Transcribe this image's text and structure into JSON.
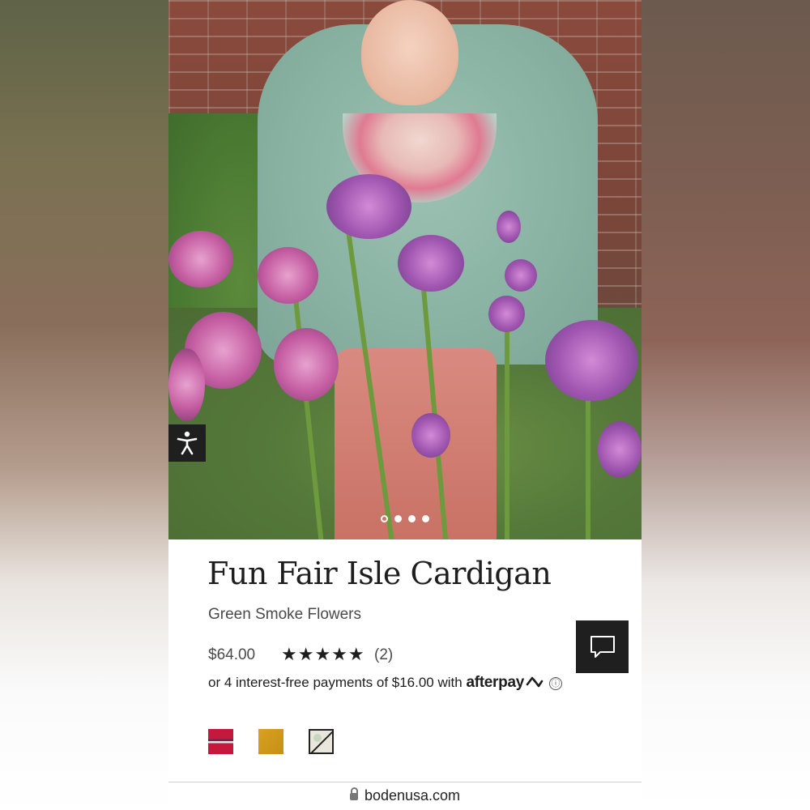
{
  "product": {
    "title": "Fun Fair Isle Cardigan",
    "color_name": "Green Smoke Flowers",
    "price": "$64.00",
    "rating_stars": "★★★★★",
    "rating_value": 5,
    "review_count": "(2)"
  },
  "afterpay": {
    "text": "or 4 interest-free payments of $16.00 with",
    "brand": "afterpay",
    "info_icon_glyph": "ⓘ"
  },
  "gallery": {
    "total_images": 4,
    "current_index": 1
  },
  "swatches": [
    {
      "name": "red-fair-isle",
      "color": "#c4183c"
    },
    {
      "name": "mustard",
      "color": "#d8a11f"
    },
    {
      "name": "unavailable",
      "color": "#e9e6dc"
    }
  ],
  "browser": {
    "url": "bodenusa.com"
  },
  "icons": {
    "accessibility": "accessibility-icon",
    "chat": "chat-icon",
    "lock": "lock-icon"
  },
  "colors": {
    "dark_button": "#1f1f1f",
    "text_primary": "#1e1e1e",
    "text_secondary": "#4a4a4a"
  }
}
